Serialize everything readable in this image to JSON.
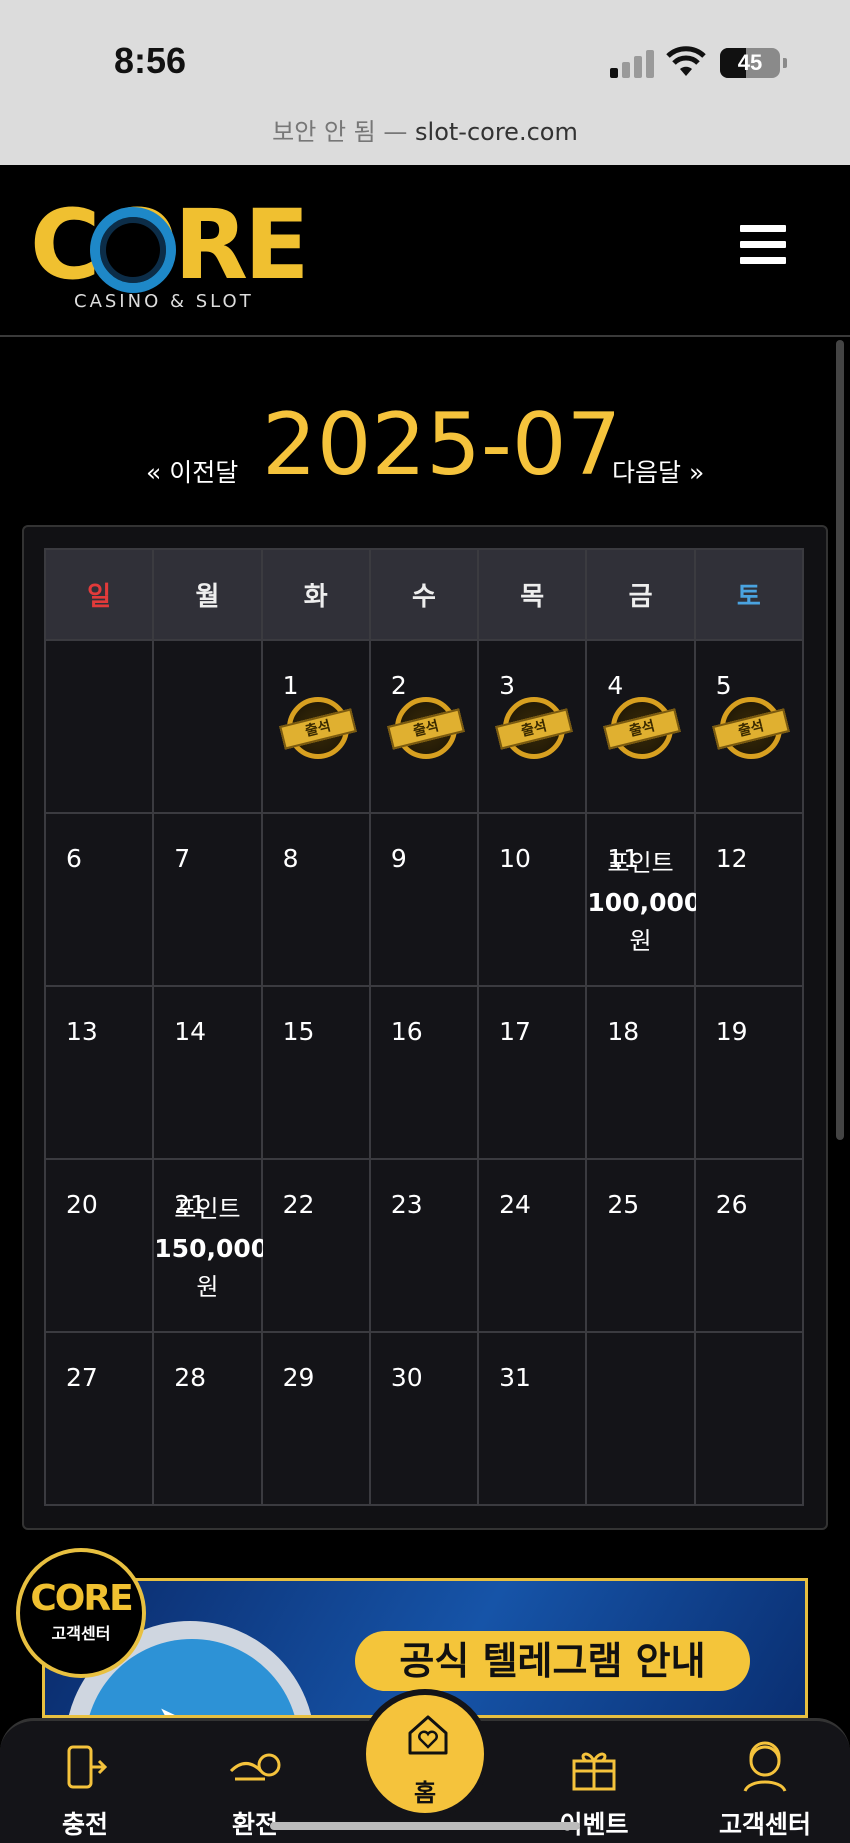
{
  "status_bar": {
    "time": "8:56",
    "battery": "45"
  },
  "url_bar": {
    "insecure_label": "보안 안 됨 —",
    "domain": "slot-core.com"
  },
  "header": {
    "logo_text": "CORE",
    "logo_subtitle": "CASINO & SLOT"
  },
  "month_nav": {
    "prev_label": "« 이전달",
    "title": "2025-07",
    "next_label": "다음달 »"
  },
  "calendar": {
    "weekdays": [
      "일",
      "월",
      "화",
      "수",
      "목",
      "금",
      "토"
    ],
    "stamp_label": "출석",
    "weeks": [
      [
        {
          "day": ""
        },
        {
          "day": ""
        },
        {
          "day": "1",
          "stamp": true
        },
        {
          "day": "2",
          "stamp": true
        },
        {
          "day": "3",
          "stamp": true
        },
        {
          "day": "4",
          "stamp": true
        },
        {
          "day": "5",
          "stamp": true
        }
      ],
      [
        {
          "day": "6"
        },
        {
          "day": "7"
        },
        {
          "day": "8"
        },
        {
          "day": "9"
        },
        {
          "day": "10"
        },
        {
          "day": "11",
          "point_label": "포인트",
          "point_amount": "100,000",
          "point_unit": "원"
        },
        {
          "day": "12"
        }
      ],
      [
        {
          "day": "13"
        },
        {
          "day": "14"
        },
        {
          "day": "15"
        },
        {
          "day": "16"
        },
        {
          "day": "17"
        },
        {
          "day": "18"
        },
        {
          "day": "19"
        }
      ],
      [
        {
          "day": "20"
        },
        {
          "day": "21",
          "point_label": "포인트",
          "point_amount": "150,000",
          "point_unit": "원"
        },
        {
          "day": "22"
        },
        {
          "day": "23"
        },
        {
          "day": "24"
        },
        {
          "day": "25"
        },
        {
          "day": "26"
        }
      ],
      [
        {
          "day": "27"
        },
        {
          "day": "28"
        },
        {
          "day": "29"
        },
        {
          "day": "30"
        },
        {
          "day": "31"
        },
        {
          "day": ""
        },
        {
          "day": ""
        }
      ]
    ]
  },
  "cs_badge": {
    "logo": "CORE",
    "label": "고객센터"
  },
  "banner": {
    "title": "공식 텔레그램 안내",
    "icon": "telegram-icon"
  },
  "bottom_nav": {
    "items": [
      {
        "label": "충전",
        "icon": "deposit-icon"
      },
      {
        "label": "환전",
        "icon": "withdraw-icon"
      },
      {
        "label": "홈",
        "icon": "home-heart-icon"
      },
      {
        "label": "이벤트",
        "icon": "gift-icon"
      },
      {
        "label": "고객센터",
        "icon": "headset-icon"
      }
    ]
  },
  "colors": {
    "accent": "#f5c33c",
    "sunday": "#e23a3a",
    "saturday": "#4aa3e0",
    "background": "#000000"
  }
}
